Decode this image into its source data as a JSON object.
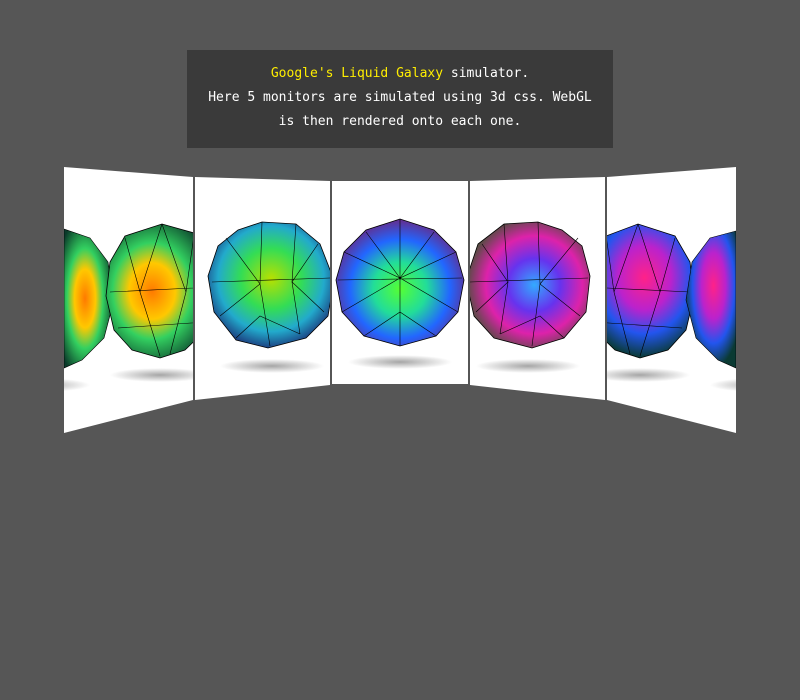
{
  "info": {
    "link_text": "Google's Liquid Galaxy",
    "line1_rest": " simulator.",
    "line2": "Here 5 monitors are simulated using 3d css. WebGL",
    "line3": "is then rendered onto each one."
  },
  "colors": {
    "background": "#565656",
    "panel": "#3a3a3a",
    "highlight": "#ffee00",
    "monitor": "#ffffff"
  },
  "monitors": [
    {
      "name": "monitor-1",
      "content": "geodesic-sphere",
      "sphere_colors": [
        "#55aa33",
        "#ffaa00",
        "#33cc77",
        "#ff5500",
        "#c0e040"
      ]
    },
    {
      "name": "monitor-2",
      "content": "geodesic-sphere",
      "sphere_colors": [
        "#1a4dbf",
        "#33e06a",
        "#c8d800",
        "#ff6a00",
        "#2ad0c0"
      ]
    },
    {
      "name": "monitor-3",
      "content": "geodesic-sphere",
      "sphere_colors": [
        "#b0208a",
        "#3355ff",
        "#22dd88",
        "#55ff33",
        "#cc7700"
      ]
    },
    {
      "name": "monitor-4",
      "content": "geodesic-sphere",
      "sphere_colors": [
        "#dd2266",
        "#8a22cc",
        "#3366ff",
        "#22cc88",
        "#77dd33"
      ]
    },
    {
      "name": "monitor-5",
      "content": "geodesic-sphere",
      "sphere_colors": [
        "#bb1144",
        "#ff2277",
        "#6633dd",
        "#2255ee",
        "#22bb99"
      ]
    }
  ]
}
